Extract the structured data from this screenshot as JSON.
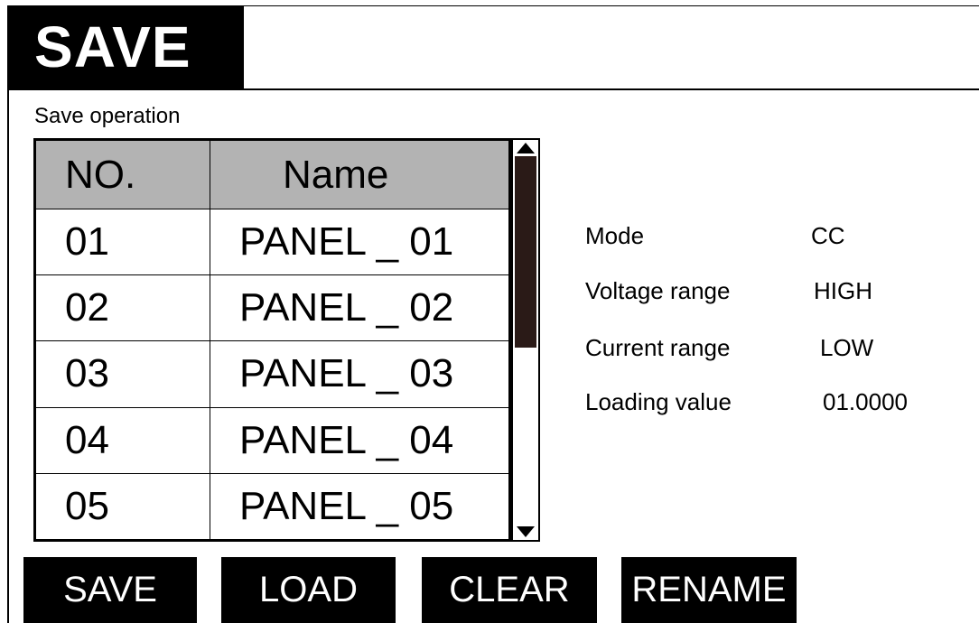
{
  "header": {
    "title": "SAVE"
  },
  "section_label": "Save operation",
  "table": {
    "columns": [
      "NO.",
      "Name"
    ],
    "rows": [
      {
        "no": "01",
        "name": "PANEL _ 01"
      },
      {
        "no": "02",
        "name": "PANEL _ 02"
      },
      {
        "no": "03",
        "name": "PANEL _ 03"
      },
      {
        "no": "04",
        "name": "PANEL _ 04"
      },
      {
        "no": "05",
        "name": "PANEL _ 05"
      }
    ]
  },
  "scrollbar": {
    "up_icon": "triangle-up-icon",
    "down_icon": "triangle-down-icon"
  },
  "info": {
    "mode_label": "Mode",
    "mode_value": "CC",
    "voltage_label": "Voltage range",
    "voltage_value": "HIGH",
    "current_label": "Current range",
    "current_value": "LOW",
    "loading_label": "Loading value",
    "loading_value": "01.0000"
  },
  "buttons": {
    "save": "SAVE",
    "load": "LOAD",
    "clear": "CLEAR",
    "rename": "RENAME"
  },
  "colors": {
    "header_bg": "#000000",
    "table_header_bg": "#b3b3b3",
    "scroll_thumb": "#2a1a17",
    "button_bg": "#000000",
    "button_text": "#ffffff"
  }
}
